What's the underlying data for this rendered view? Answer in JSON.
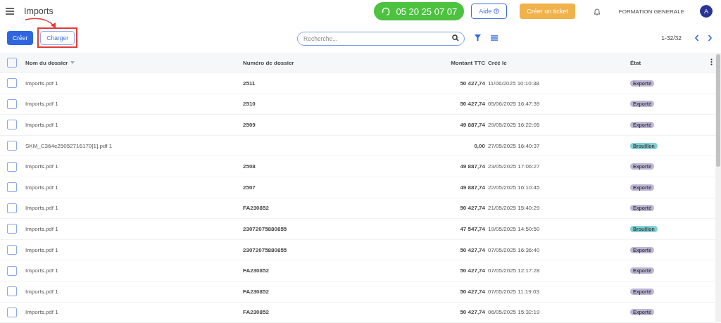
{
  "header": {
    "title": "Imports",
    "phone": "05 20 25 07 07",
    "help": "Aide",
    "ticket": "Créer un ticket",
    "account": "FORMATION GENERALE",
    "avatar": "A"
  },
  "toolbar": {
    "create": "Créer",
    "upload": "Charger",
    "search": {
      "placeholder": "Recherche..."
    },
    "pagination": "1-32/32"
  },
  "table": {
    "columns": [
      "Nom du dossier",
      "Numéro de dossier",
      "Montant TTC",
      "Créé le",
      "État"
    ],
    "header_checked": false,
    "rows": [
      {
        "checked": false,
        "name": "Imports.pdf 1",
        "number": "2511",
        "amount": "50 427,74",
        "created": "11/06/2025 10:10:38",
        "status": {
          "label": "Exporté",
          "color": "#bdb6d6"
        }
      },
      {
        "checked": false,
        "name": "Imports.pdf 1",
        "number": "2510",
        "amount": "50 427,74",
        "created": "05/06/2025 16:47:39",
        "status": {
          "label": "Exporté",
          "color": "#bdb6d6"
        }
      },
      {
        "checked": false,
        "name": "Imports.pdf 1",
        "number": "2509",
        "amount": "49 887,74",
        "created": "29/05/2025 16:22:05",
        "status": {
          "label": "Exporté",
          "color": "#bdb6d6"
        }
      },
      {
        "checked": false,
        "name": "SKM_C364e25052716170[1].pdf 1",
        "amount": "0,00",
        "created": "27/05/2025 16:40:37",
        "status": {
          "label": "Brouillon",
          "color": "#7fd1d8"
        }
      },
      {
        "checked": false,
        "name": "Imports.pdf 1",
        "number": "2508",
        "amount": "49 887,74",
        "created": "23/05/2025 17:06:27",
        "status": {
          "label": "Exporté",
          "color": "#bdb6d6"
        }
      },
      {
        "checked": false,
        "name": "Imports.pdf 1",
        "number": "2507",
        "amount": "49 887,74",
        "created": "22/05/2025 16:10:45",
        "status": {
          "label": "Exporté",
          "color": "#bdb6d6"
        }
      },
      {
        "checked": false,
        "name": "Imports.pdf 1",
        "number": "FA230852",
        "amount": "50 427,74",
        "created": "21/05/2025 15:40:29",
        "status": {
          "label": "Exporté",
          "color": "#bdb6d6"
        }
      },
      {
        "checked": false,
        "name": "Imports.pdf 1",
        "number": "23072075880855",
        "amount": "47 547,74",
        "created": "19/05/2025 14:50:50",
        "status": {
          "label": "Brouillon",
          "color": "#7fd1d8"
        }
      },
      {
        "checked": false,
        "name": "Imports.pdf 1",
        "number": "23072075880855",
        "amount": "50 427,74",
        "created": "07/05/2025 16:36:40",
        "status": {
          "label": "Exporté",
          "color": "#bdb6d6"
        }
      },
      {
        "checked": false,
        "name": "Imports.pdf 1",
        "number": "FA230852",
        "amount": "50 427,74",
        "created": "07/05/2025 12:17:28",
        "status": {
          "label": "Exporté",
          "color": "#bdb6d6"
        }
      },
      {
        "checked": false,
        "name": "Imports.pdf 1",
        "number": "FA230852",
        "amount": "50 427,74",
        "created": "07/05/2025 11:19:03",
        "status": {
          "label": "Exporté",
          "color": "#bdb6d6"
        }
      },
      {
        "checked": false,
        "name": "Imports.pdf 1",
        "number": "FA230852",
        "amount": "50 427,74",
        "created": "06/05/2025 15:32:19",
        "status": {
          "label": "Exporté",
          "color": "#bdb6d6"
        }
      }
    ]
  }
}
